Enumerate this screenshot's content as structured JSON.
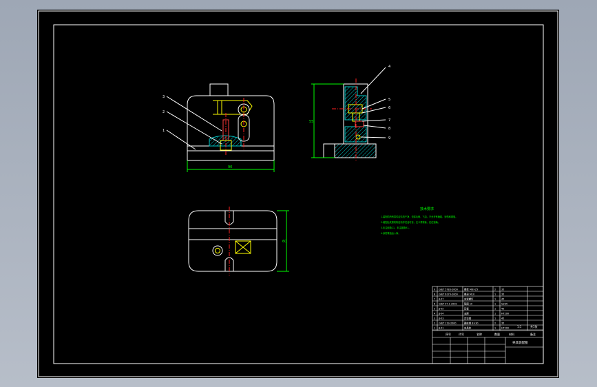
{
  "colors": {
    "frame": "#ffffff",
    "outline": "#ffffff",
    "dimension": "#00ff00",
    "centerline": "#ff2020",
    "hatch": "#00c8c8",
    "note": "#00ff00"
  },
  "front_view": {
    "balloons": [
      "3",
      "2",
      "1"
    ],
    "width_dim": "90"
  },
  "side_view": {
    "balloons": [
      "4",
      "5",
      "6",
      "7",
      "8",
      "9"
    ],
    "height_dim": "55"
  },
  "top_view": {
    "height_dim": "60"
  },
  "tech_notes": {
    "title": "技术要求",
    "lines": [
      "1.装配前所有零件应清洗干净，去除毛刺、飞边，不允许有磕碰、划伤和锈蚀。",
      "2.装配后夹紧机构应动作灵活可靠，无卡滞现象，定位准确。",
      "3.未注倒角C1，未注圆角R1。",
      "4.涂防锈油后入库。"
    ]
  },
  "title_block": {
    "parts": [
      {
        "no": "9",
        "code": "GB/T 5783-2000",
        "name": "螺栓 M8×25",
        "qty": "2",
        "mat": "35"
      },
      {
        "no": "8",
        "code": "GB/T 6170-2000",
        "name": "螺母 M10",
        "qty": "1",
        "mat": "35"
      },
      {
        "no": "7",
        "code": "JJ-07",
        "name": "夹紧螺钉",
        "qty": "1",
        "mat": "45"
      },
      {
        "no": "6",
        "code": "GB/T 97.1-2002",
        "name": "垫圈 10",
        "qty": "1",
        "mat": "Q235"
      },
      {
        "no": "5",
        "code": "JJ-05",
        "name": "压板",
        "qty": "1",
        "mat": "45"
      },
      {
        "no": "4",
        "code": "JJ-04",
        "name": "支座",
        "qty": "1",
        "mat": "HT200"
      },
      {
        "no": "3",
        "code": "JJ-03",
        "name": "定位销",
        "qty": "1",
        "mat": "45"
      },
      {
        "no": "2",
        "code": "GB/T 119-2000",
        "name": "圆柱销 8×30",
        "qty": "2",
        "mat": "35"
      },
      {
        "no": "1",
        "code": "JJ-01",
        "name": "夹具体",
        "qty": "1",
        "mat": "HT200"
      }
    ],
    "header": {
      "no": "序号",
      "code": "代号",
      "name": "名称",
      "qty": "数量",
      "mat": "材料",
      "remark": "备注"
    },
    "drawing_title": "夹具装配图",
    "scale": "1:1",
    "sheet": "共1张"
  }
}
